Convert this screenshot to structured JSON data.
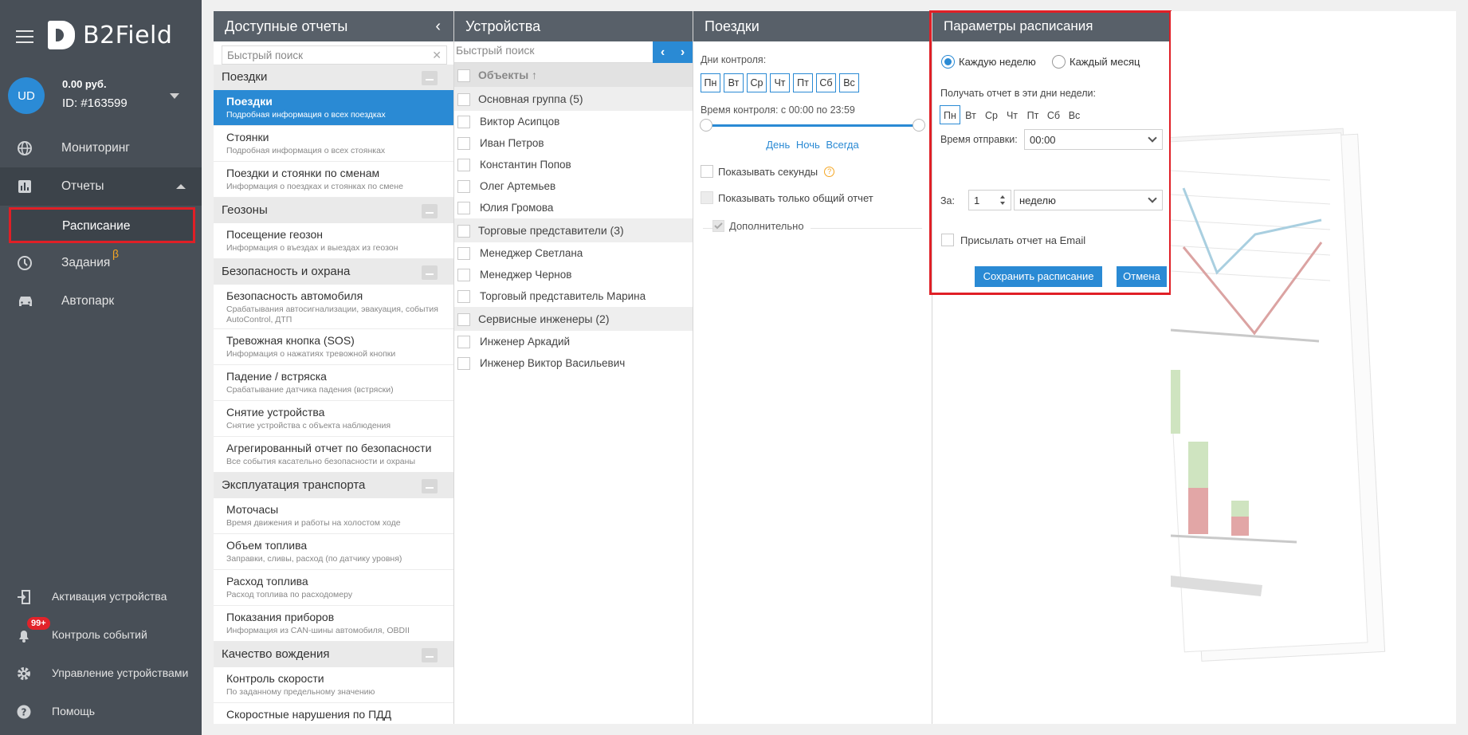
{
  "brand": {
    "name": "B2Field"
  },
  "user": {
    "initials": "UD",
    "balance": "0.00 руб.",
    "id": "ID: #163599"
  },
  "nav": {
    "monitoring": "Мониторинг",
    "reports": "Отчеты",
    "schedule": "Расписание",
    "tasks": "Задания",
    "beta": "β",
    "fleet": "Автопарк",
    "activation": "Активация устройства",
    "events": "Контроль событий",
    "events_badge": "99+",
    "device_mgmt": "Управление устройствами",
    "help": "Помощь"
  },
  "reports_panel": {
    "title": "Доступные отчеты",
    "search_placeholder": "Быстрый поиск",
    "groups": [
      {
        "name": "Поездки",
        "items": [
          {
            "title": "Поездки",
            "desc": "Подробная информация о всех поездках",
            "selected": true
          },
          {
            "title": "Стоянки",
            "desc": "Подробная информация о всех стоянках"
          },
          {
            "title": "Поездки и стоянки по сменам",
            "desc": "Информация о поездках и стоянках по смене"
          }
        ]
      },
      {
        "name": "Геозоны",
        "items": [
          {
            "title": "Посещение геозон",
            "desc": "Информация о въездах и выездах из геозон"
          }
        ]
      },
      {
        "name": "Безопасность и охрана",
        "items": [
          {
            "title": "Безопасность автомобиля",
            "desc": "Срабатывания автосигнализации, эвакуация, события AutoControl, ДТП"
          },
          {
            "title": "Тревожная кнопка (SOS)",
            "desc": "Информация о нажатиях тревожной кнопки"
          },
          {
            "title": "Падение / встряска",
            "desc": "Срабатывание датчика падения (встряски)"
          },
          {
            "title": "Снятие устройства",
            "desc": "Снятие устройства с объекта наблюдения"
          },
          {
            "title": "Агрегированный отчет по безопасности",
            "desc": "Все события касательно безопасности и охраны"
          }
        ]
      },
      {
        "name": "Эксплуатация транспорта",
        "items": [
          {
            "title": "Моточасы",
            "desc": "Время движения и работы на холостом ходе"
          },
          {
            "title": "Объем топлива",
            "desc": "Заправки, сливы, расход (по датчику уровня)"
          },
          {
            "title": "Расход топлива",
            "desc": "Расход топлива по расходомеру"
          },
          {
            "title": "Показания приборов",
            "desc": "Информация из CAN-шины автомобиля, OBDII"
          }
        ]
      },
      {
        "name": "Качество вождения",
        "items": [
          {
            "title": "Контроль скорости",
            "desc": "По заданному предельному значению"
          },
          {
            "title": "Скоростные нарушения по ПДД",
            "desc": ""
          }
        ]
      }
    ]
  },
  "devices_panel": {
    "title": "Устройства",
    "search_placeholder": "Быстрый поиск",
    "header": "Объекты ↑",
    "groups": [
      {
        "name": "Основная группа (5)",
        "items": [
          "Виктор Асипцов",
          "Иван Петров",
          "Константин Попов",
          "Олег Артемьев",
          "Юлия Громова"
        ]
      },
      {
        "name": "Торговые представители (3)",
        "items": [
          "Менеджер Светлана",
          "Менеджер Чернов",
          "Торговый представитель Марина"
        ]
      },
      {
        "name": "Сервисные инженеры (2)",
        "items": [
          "Инженер Аркадий",
          "Инженер Виктор Васильевич"
        ]
      }
    ]
  },
  "trips_panel": {
    "title": "Поездки",
    "days_label": "Дни контроля:",
    "days": [
      "Пн",
      "Вт",
      "Ср",
      "Чт",
      "Пт",
      "Сб",
      "Вс"
    ],
    "time_label": "Время контроля: с 00:00 по 23:59",
    "links": [
      "День",
      "Ночь",
      "Всегда"
    ],
    "show_seconds": "Показывать секунды",
    "show_total_only": "Показывать только общий отчет",
    "extra": "Дополнительно"
  },
  "schedule_panel": {
    "title": "Параметры расписания",
    "weekly": "Каждую неделю",
    "monthly": "Каждый месяц",
    "days_label": "Получать отчет в эти дни недели:",
    "days": [
      "Пн",
      "Вт",
      "Ср",
      "Чт",
      "Пт",
      "Сб",
      "Вс"
    ],
    "send_time_label": "Время отправки:",
    "send_time": "00:00",
    "period_label": "За:",
    "period_count": "1",
    "period_unit": "неделю",
    "email_label": "Присылать отчет на Email",
    "save": "Сохранить расписание",
    "cancel": "Отмена"
  },
  "colors": {
    "accent": "#2a8ad4",
    "sidebar": "#484f57",
    "header": "#586069",
    "highlight": "#e01f26",
    "badge": "#e2232a",
    "beta": "#f5a623"
  }
}
